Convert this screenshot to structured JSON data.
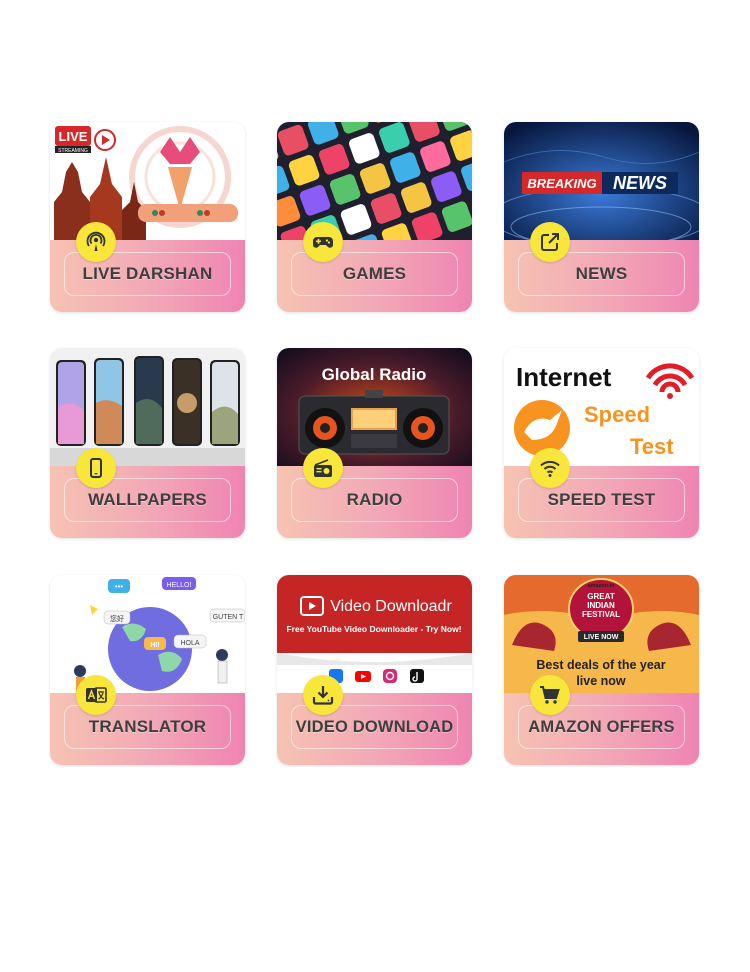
{
  "tiles": [
    {
      "label": "LIVE DARSHAN",
      "icon": "podcast-icon",
      "thumb": {
        "badge_top": "LIVE",
        "badge_bottom": "STREAMING"
      }
    },
    {
      "label": "GAMES",
      "icon": "gamepad-icon",
      "thumb": {}
    },
    {
      "label": "NEWS",
      "icon": "external-link-icon",
      "thumb": {
        "breaking": "BREAKING",
        "news": "NEWS"
      }
    },
    {
      "label": "WALLPAPERS",
      "icon": "smartphone-icon",
      "thumb": {}
    },
    {
      "label": "RADIO",
      "icon": "radio-icon",
      "thumb": {
        "title": "Global Radio"
      }
    },
    {
      "label": "SPEED TEST",
      "icon": "wifi-icon",
      "thumb": {
        "line1": "Internet",
        "line2": "Speed",
        "line3": "Test"
      }
    },
    {
      "label": "TRANSLATOR",
      "icon": "translate-icon",
      "thumb": {
        "b1": "HELLO!",
        "b2": "HOLA",
        "b3": "GUTEN T",
        "b4": "HI!",
        "b5": "您好"
      }
    },
    {
      "label": "VIDEO DOWNLOAD",
      "icon": "download-icon",
      "thumb": {
        "title": "Video Downloadr",
        "subtitle": "Free YouTube Video Downloader - Try Now!"
      }
    },
    {
      "label": "AMAZON OFFERS",
      "icon": "cart-icon",
      "thumb": {
        "brand": "amazon.in",
        "l1": "GREAT",
        "l2": "INDIAN",
        "l3": "FESTIVAL",
        "l4": "LIVE NOW",
        "deal1": "Best deals of the year",
        "deal2": "live now"
      }
    }
  ],
  "colors": {
    "badge": "#f8e63a",
    "gradient_start": "#f6c3b2",
    "gradient_end": "#ef84b2",
    "label_text": "#3e3e3e"
  }
}
